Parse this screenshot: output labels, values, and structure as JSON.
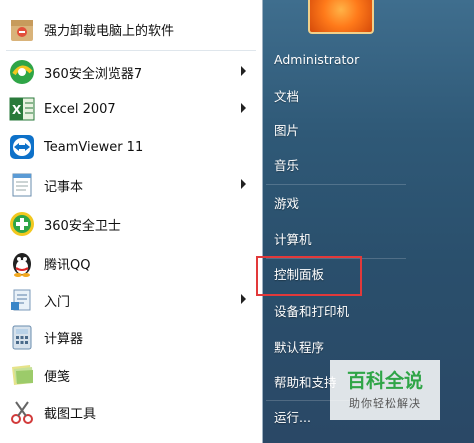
{
  "left_menu": {
    "items": [
      {
        "label": "强力卸载电脑上的软件",
        "icon": "uninstall-box-icon",
        "has_submenu": false
      },
      {
        "label": "360安全浏览器7",
        "icon": "360-browser-icon",
        "has_submenu": true
      },
      {
        "label": "Excel 2007",
        "icon": "excel-icon",
        "has_submenu": true
      },
      {
        "label": "TeamViewer 11",
        "icon": "teamviewer-icon",
        "has_submenu": false
      },
      {
        "label": "记事本",
        "icon": "notepad-icon",
        "has_submenu": true
      },
      {
        "label": "360安全卫士",
        "icon": "360-security-icon",
        "has_submenu": false
      },
      {
        "label": "腾讯QQ",
        "icon": "qq-penguin-icon",
        "has_submenu": false
      },
      {
        "label": "入门",
        "icon": "getting-started-icon",
        "has_submenu": true
      },
      {
        "label": "计算器",
        "icon": "calculator-icon",
        "has_submenu": false
      },
      {
        "label": "便笺",
        "icon": "sticky-notes-icon",
        "has_submenu": false
      },
      {
        "label": "截图工具",
        "icon": "snipping-tool-icon",
        "has_submenu": false
      }
    ]
  },
  "right_menu": {
    "items": [
      {
        "label": "Administrator"
      },
      {
        "label": "文档"
      },
      {
        "label": "图片"
      },
      {
        "label": "音乐"
      },
      {
        "label": "游戏"
      },
      {
        "label": "计算机"
      },
      {
        "label": "控制面板"
      },
      {
        "label": "设备和打印机"
      },
      {
        "label": "默认程序"
      },
      {
        "label": "帮助和支持"
      },
      {
        "label": "运行..."
      }
    ]
  },
  "watermark": {
    "title": "百科全说",
    "subtitle": "助你轻松解决"
  },
  "colors": {
    "highlight": "#e2393a",
    "right_pane": "#2f5977"
  }
}
